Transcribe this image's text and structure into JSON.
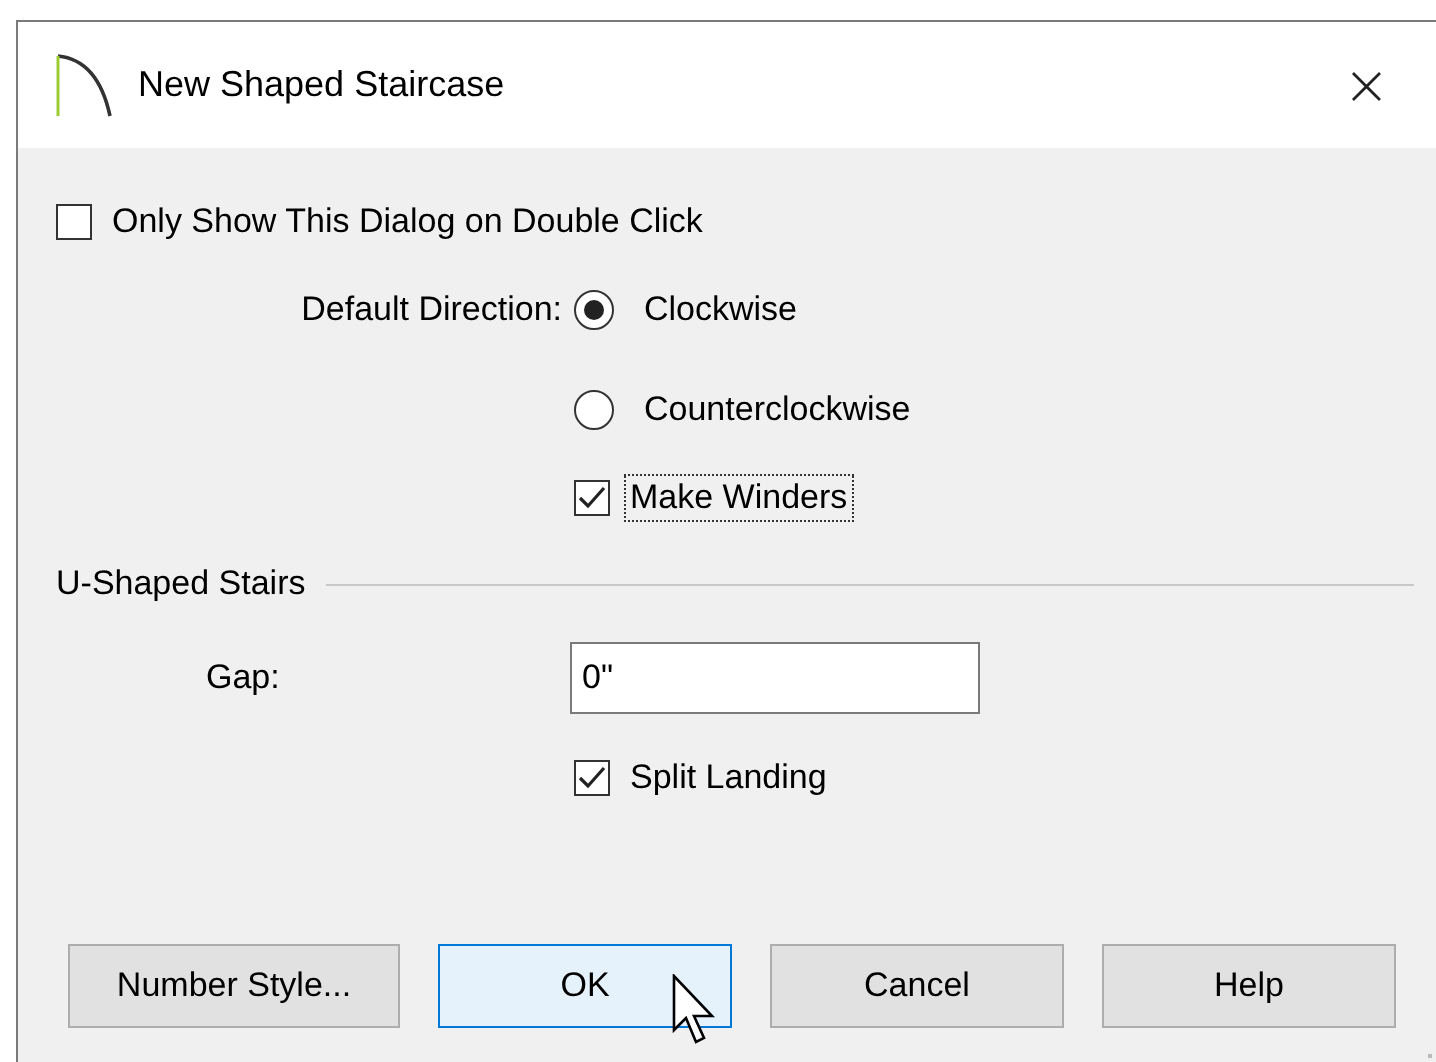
{
  "window": {
    "title": "New Shaped Staircase",
    "close": "×"
  },
  "only_show_on_double_click": {
    "label": "Only Show This Dialog on Double Click",
    "checked": false
  },
  "default_direction": {
    "label": "Default Direction:",
    "options": [
      {
        "label": "Clockwise",
        "selected": true
      },
      {
        "label": "Counterclockwise",
        "selected": false
      }
    ]
  },
  "make_winders": {
    "label": "Make Winders",
    "checked": true,
    "focused": true
  },
  "u_shaped_stairs": {
    "title": "U-Shaped Stairs",
    "gap": {
      "label": "Gap:",
      "value": "0\""
    },
    "split_landing": {
      "label": "Split Landing",
      "checked": true
    }
  },
  "buttons": [
    {
      "label": "Number Style...",
      "default": false
    },
    {
      "label": "OK",
      "default": true
    },
    {
      "label": "Cancel",
      "default": false
    },
    {
      "label": "Help",
      "default": false
    }
  ]
}
